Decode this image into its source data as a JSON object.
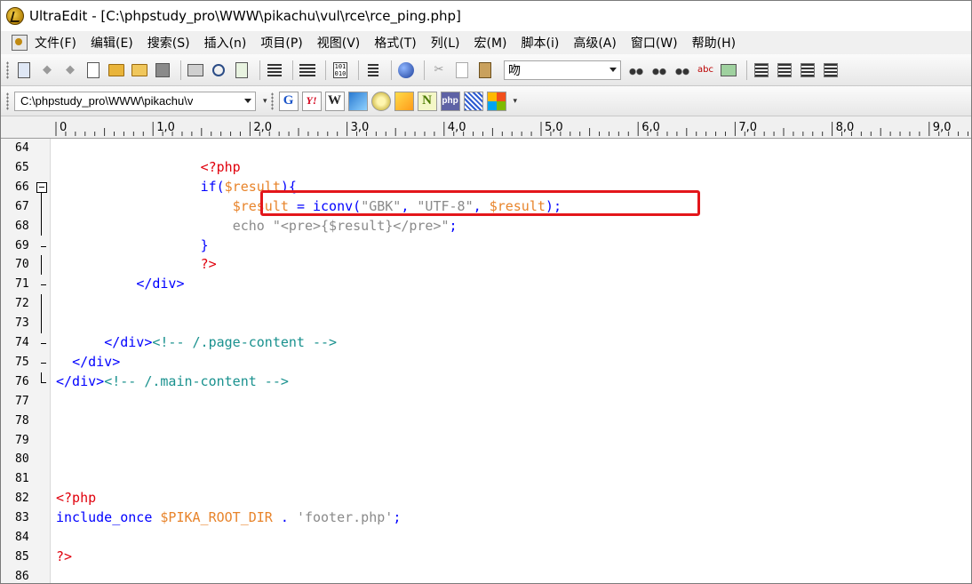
{
  "window": {
    "title": "UltraEdit - [C:\\phpstudy_pro\\WWW\\pikachu\\vul\\rce\\rce_ping.php]"
  },
  "menu": {
    "items": [
      "文件(F)",
      "编辑(E)",
      "搜索(S)",
      "插入(n)",
      "项目(P)",
      "视图(V)",
      "格式(T)",
      "列(L)",
      "宏(M)",
      "脚本(i)",
      "高级(A)",
      "窗口(W)",
      "帮助(H)"
    ]
  },
  "toolbar": {
    "font_value": "吻"
  },
  "toolbar2": {
    "path_value": "C:\\phpstudy_pro\\WWW\\pikachu\\v",
    "web_icons": [
      "G",
      "Y!",
      "W",
      "",
      "",
      "",
      "N",
      "php",
      "",
      ""
    ]
  },
  "ruler": {
    "labels": [
      "0",
      "1,0",
      "2,0",
      "3,0",
      "4,0",
      "5,0",
      "6,0",
      "7,0",
      "8,0",
      "9,0"
    ]
  },
  "colors": {
    "php_tag": "#e0000c",
    "keyword": "#0000ff",
    "variable": "#e8842b",
    "html_comment": "#19918e",
    "highlight_box": "#e3161b"
  },
  "editor": {
    "lines": [
      {
        "num": "64",
        "text": ""
      },
      {
        "num": "65",
        "text": "                  <?php"
      },
      {
        "num": "66",
        "text": "                  if($result){"
      },
      {
        "num": "67",
        "text": "                      $result = iconv(\"GBK\", \"UTF-8\", $result);"
      },
      {
        "num": "68",
        "text": "                      echo \"<pre>{$result}</pre>\";"
      },
      {
        "num": "69",
        "text": "                  }"
      },
      {
        "num": "70",
        "text": "                  ?>"
      },
      {
        "num": "71",
        "text": "          </div>"
      },
      {
        "num": "72",
        "text": ""
      },
      {
        "num": "73",
        "text": ""
      },
      {
        "num": "74",
        "text": "      </div><!-- /.page-content -->"
      },
      {
        "num": "75",
        "text": "  </div>"
      },
      {
        "num": "76",
        "text": "</div><!-- /.main-content -->"
      },
      {
        "num": "77",
        "text": ""
      },
      {
        "num": "78",
        "text": ""
      },
      {
        "num": "79",
        "text": ""
      },
      {
        "num": "80",
        "text": ""
      },
      {
        "num": "81",
        "text": ""
      },
      {
        "num": "82",
        "text": "<?php"
      },
      {
        "num": "83",
        "text": "include_once $PIKA_ROOT_DIR . 'footer.php';"
      },
      {
        "num": "84",
        "text": ""
      },
      {
        "num": "85",
        "text": "?>"
      },
      {
        "num": "86",
        "text": ""
      }
    ]
  }
}
